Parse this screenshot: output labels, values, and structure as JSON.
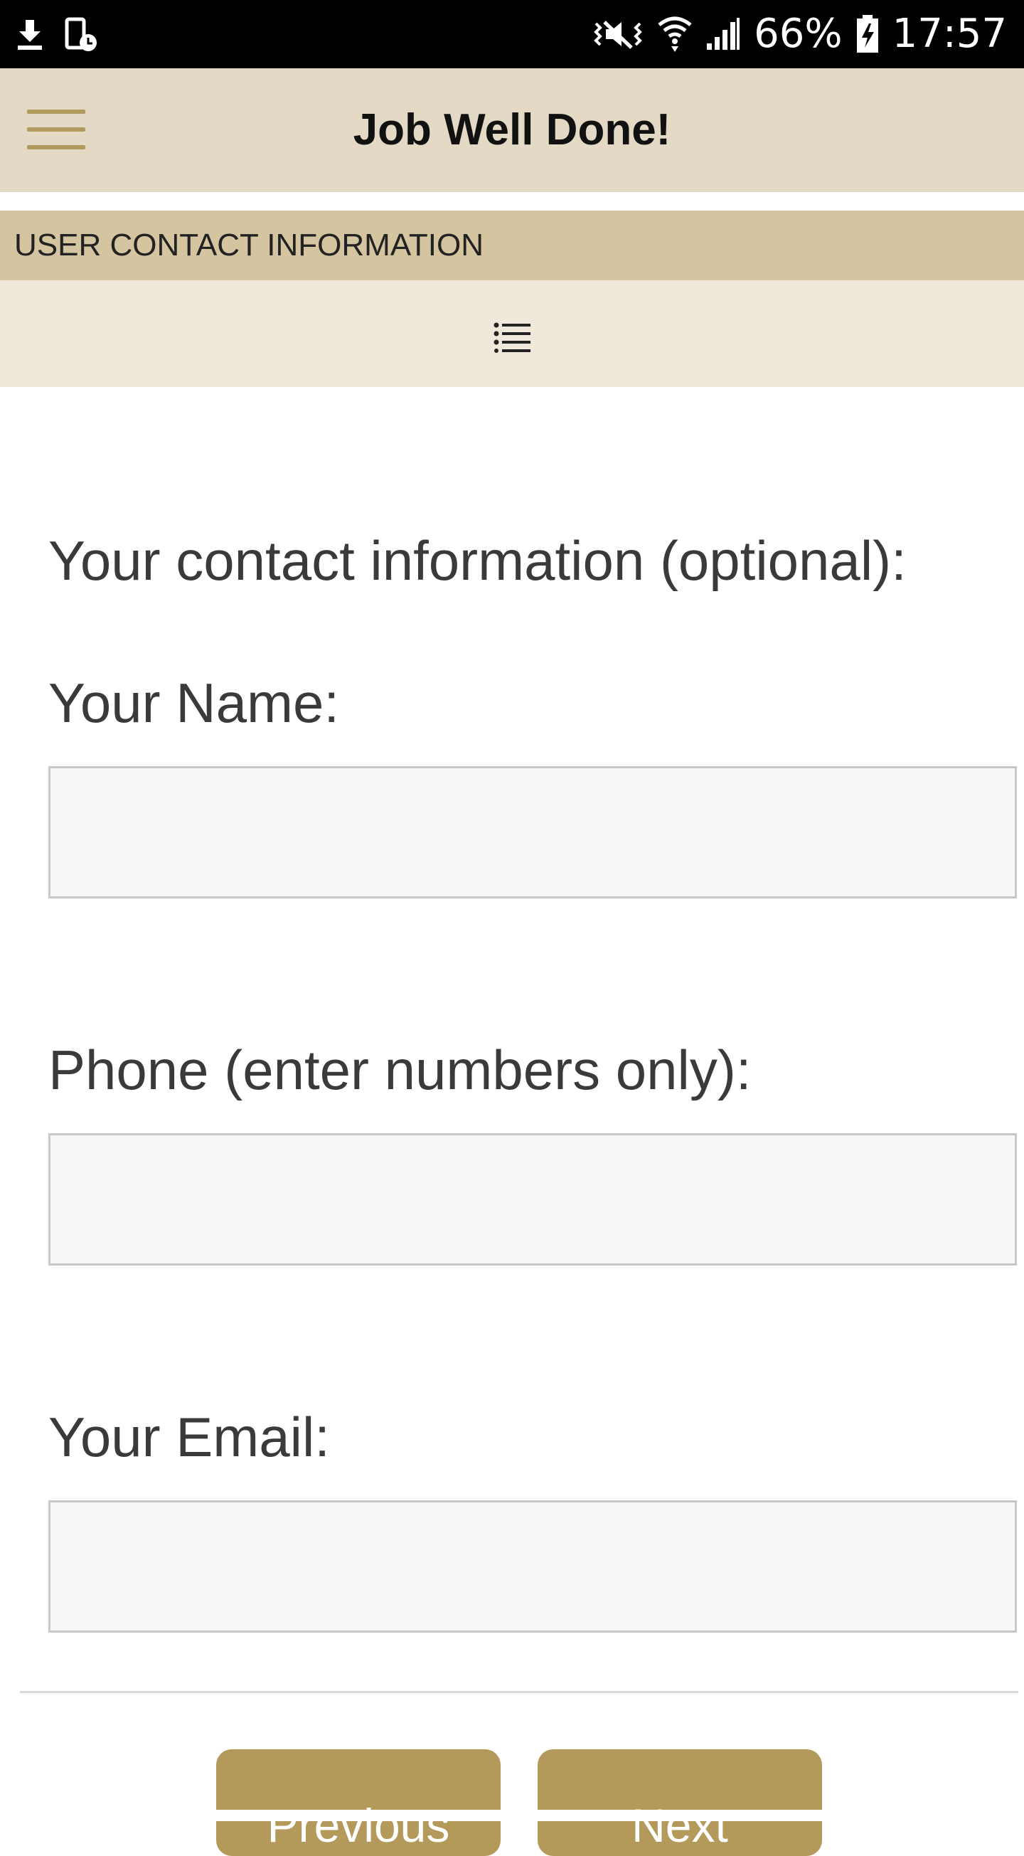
{
  "status_bar": {
    "battery": "66%",
    "time": "17:57",
    "icons": [
      "download-icon",
      "device-clock-icon",
      "vibrate-icon",
      "wifi-icon",
      "signal-icon",
      "battery-charging-icon"
    ]
  },
  "app_bar": {
    "title": "Job Well Done!",
    "menu_icon": "hamburger-menu-icon"
  },
  "section": {
    "title": "USER CONTACT INFORMATION",
    "list_icon": "list-icon"
  },
  "form": {
    "intro": "Your contact information (optional):",
    "name_label": "Your Name:",
    "name_value": "",
    "phone_label": "Phone (enter numbers only):",
    "phone_value": "",
    "email_label": "Your Email:",
    "email_value": ""
  },
  "nav": {
    "previous_label": "Previous",
    "next_label": "Next"
  },
  "colors": {
    "status_bar": "#000000",
    "app_bar": "#e3d9c4",
    "section_header": "#d4c4a0",
    "list_bar": "#f0e8da",
    "accent": "#b39a5a",
    "field_bg": "#f7f7f7",
    "field_border": "#c8c8c8",
    "text": "#3a3a3a"
  }
}
